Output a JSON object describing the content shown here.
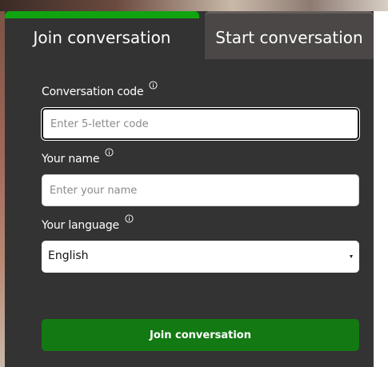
{
  "tabs": {
    "join_label": "Join conversation",
    "start_label": "Start conversation"
  },
  "form": {
    "code": {
      "label": "Conversation code",
      "placeholder": "Enter 5-letter code",
      "value": ""
    },
    "name": {
      "label": "Your name",
      "placeholder": "Enter your name",
      "value": ""
    },
    "language": {
      "label": "Your language",
      "selected": "English"
    },
    "submit_label": "Join conversation"
  },
  "icons": {
    "info": "info-icon",
    "caret": "chevron-down-icon"
  },
  "colors": {
    "panel_bg": "#333333",
    "active_tab_accent": "#10a410",
    "inactive_tab_bg": "#4a4746",
    "button_bg": "#137913",
    "text": "#ffffff"
  }
}
